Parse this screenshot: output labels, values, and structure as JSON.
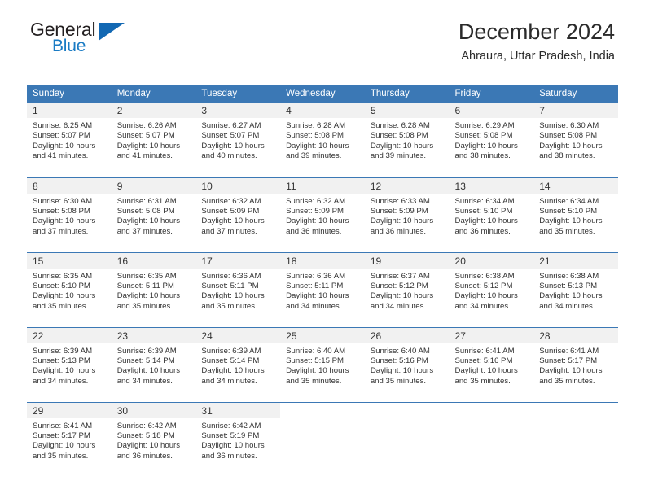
{
  "brand": {
    "word_one": "General",
    "word_two": "Blue",
    "triangle_icon": "triangle-icon"
  },
  "header": {
    "title": "December 2024",
    "subtitle": "Ahraura, Uttar Pradesh, India"
  },
  "calendar": {
    "weekday_headers": [
      "Sunday",
      "Monday",
      "Tuesday",
      "Wednesday",
      "Thursday",
      "Friday",
      "Saturday"
    ],
    "accent_color": "#3b78b5",
    "daynum_bg": "#f1f1f1",
    "weeks": [
      [
        {
          "day": "1",
          "sunrise": "Sunrise: 6:25 AM",
          "sunset": "Sunset: 5:07 PM",
          "daylight1": "Daylight: 10 hours",
          "daylight2": "and 41 minutes."
        },
        {
          "day": "2",
          "sunrise": "Sunrise: 6:26 AM",
          "sunset": "Sunset: 5:07 PM",
          "daylight1": "Daylight: 10 hours",
          "daylight2": "and 41 minutes."
        },
        {
          "day": "3",
          "sunrise": "Sunrise: 6:27 AM",
          "sunset": "Sunset: 5:07 PM",
          "daylight1": "Daylight: 10 hours",
          "daylight2": "and 40 minutes."
        },
        {
          "day": "4",
          "sunrise": "Sunrise: 6:28 AM",
          "sunset": "Sunset: 5:08 PM",
          "daylight1": "Daylight: 10 hours",
          "daylight2": "and 39 minutes."
        },
        {
          "day": "5",
          "sunrise": "Sunrise: 6:28 AM",
          "sunset": "Sunset: 5:08 PM",
          "daylight1": "Daylight: 10 hours",
          "daylight2": "and 39 minutes."
        },
        {
          "day": "6",
          "sunrise": "Sunrise: 6:29 AM",
          "sunset": "Sunset: 5:08 PM",
          "daylight1": "Daylight: 10 hours",
          "daylight2": "and 38 minutes."
        },
        {
          "day": "7",
          "sunrise": "Sunrise: 6:30 AM",
          "sunset": "Sunset: 5:08 PM",
          "daylight1": "Daylight: 10 hours",
          "daylight2": "and 38 minutes."
        }
      ],
      [
        {
          "day": "8",
          "sunrise": "Sunrise: 6:30 AM",
          "sunset": "Sunset: 5:08 PM",
          "daylight1": "Daylight: 10 hours",
          "daylight2": "and 37 minutes."
        },
        {
          "day": "9",
          "sunrise": "Sunrise: 6:31 AM",
          "sunset": "Sunset: 5:08 PM",
          "daylight1": "Daylight: 10 hours",
          "daylight2": "and 37 minutes."
        },
        {
          "day": "10",
          "sunrise": "Sunrise: 6:32 AM",
          "sunset": "Sunset: 5:09 PM",
          "daylight1": "Daylight: 10 hours",
          "daylight2": "and 37 minutes."
        },
        {
          "day": "11",
          "sunrise": "Sunrise: 6:32 AM",
          "sunset": "Sunset: 5:09 PM",
          "daylight1": "Daylight: 10 hours",
          "daylight2": "and 36 minutes."
        },
        {
          "day": "12",
          "sunrise": "Sunrise: 6:33 AM",
          "sunset": "Sunset: 5:09 PM",
          "daylight1": "Daylight: 10 hours",
          "daylight2": "and 36 minutes."
        },
        {
          "day": "13",
          "sunrise": "Sunrise: 6:34 AM",
          "sunset": "Sunset: 5:10 PM",
          "daylight1": "Daylight: 10 hours",
          "daylight2": "and 36 minutes."
        },
        {
          "day": "14",
          "sunrise": "Sunrise: 6:34 AM",
          "sunset": "Sunset: 5:10 PM",
          "daylight1": "Daylight: 10 hours",
          "daylight2": "and 35 minutes."
        }
      ],
      [
        {
          "day": "15",
          "sunrise": "Sunrise: 6:35 AM",
          "sunset": "Sunset: 5:10 PM",
          "daylight1": "Daylight: 10 hours",
          "daylight2": "and 35 minutes."
        },
        {
          "day": "16",
          "sunrise": "Sunrise: 6:35 AM",
          "sunset": "Sunset: 5:11 PM",
          "daylight1": "Daylight: 10 hours",
          "daylight2": "and 35 minutes."
        },
        {
          "day": "17",
          "sunrise": "Sunrise: 6:36 AM",
          "sunset": "Sunset: 5:11 PM",
          "daylight1": "Daylight: 10 hours",
          "daylight2": "and 35 minutes."
        },
        {
          "day": "18",
          "sunrise": "Sunrise: 6:36 AM",
          "sunset": "Sunset: 5:11 PM",
          "daylight1": "Daylight: 10 hours",
          "daylight2": "and 34 minutes."
        },
        {
          "day": "19",
          "sunrise": "Sunrise: 6:37 AM",
          "sunset": "Sunset: 5:12 PM",
          "daylight1": "Daylight: 10 hours",
          "daylight2": "and 34 minutes."
        },
        {
          "day": "20",
          "sunrise": "Sunrise: 6:38 AM",
          "sunset": "Sunset: 5:12 PM",
          "daylight1": "Daylight: 10 hours",
          "daylight2": "and 34 minutes."
        },
        {
          "day": "21",
          "sunrise": "Sunrise: 6:38 AM",
          "sunset": "Sunset: 5:13 PM",
          "daylight1": "Daylight: 10 hours",
          "daylight2": "and 34 minutes."
        }
      ],
      [
        {
          "day": "22",
          "sunrise": "Sunrise: 6:39 AM",
          "sunset": "Sunset: 5:13 PM",
          "daylight1": "Daylight: 10 hours",
          "daylight2": "and 34 minutes."
        },
        {
          "day": "23",
          "sunrise": "Sunrise: 6:39 AM",
          "sunset": "Sunset: 5:14 PM",
          "daylight1": "Daylight: 10 hours",
          "daylight2": "and 34 minutes."
        },
        {
          "day": "24",
          "sunrise": "Sunrise: 6:39 AM",
          "sunset": "Sunset: 5:14 PM",
          "daylight1": "Daylight: 10 hours",
          "daylight2": "and 34 minutes."
        },
        {
          "day": "25",
          "sunrise": "Sunrise: 6:40 AM",
          "sunset": "Sunset: 5:15 PM",
          "daylight1": "Daylight: 10 hours",
          "daylight2": "and 35 minutes."
        },
        {
          "day": "26",
          "sunrise": "Sunrise: 6:40 AM",
          "sunset": "Sunset: 5:16 PM",
          "daylight1": "Daylight: 10 hours",
          "daylight2": "and 35 minutes."
        },
        {
          "day": "27",
          "sunrise": "Sunrise: 6:41 AM",
          "sunset": "Sunset: 5:16 PM",
          "daylight1": "Daylight: 10 hours",
          "daylight2": "and 35 minutes."
        },
        {
          "day": "28",
          "sunrise": "Sunrise: 6:41 AM",
          "sunset": "Sunset: 5:17 PM",
          "daylight1": "Daylight: 10 hours",
          "daylight2": "and 35 minutes."
        }
      ],
      [
        {
          "day": "29",
          "sunrise": "Sunrise: 6:41 AM",
          "sunset": "Sunset: 5:17 PM",
          "daylight1": "Daylight: 10 hours",
          "daylight2": "and 35 minutes."
        },
        {
          "day": "30",
          "sunrise": "Sunrise: 6:42 AM",
          "sunset": "Sunset: 5:18 PM",
          "daylight1": "Daylight: 10 hours",
          "daylight2": "and 36 minutes."
        },
        {
          "day": "31",
          "sunrise": "Sunrise: 6:42 AM",
          "sunset": "Sunset: 5:19 PM",
          "daylight1": "Daylight: 10 hours",
          "daylight2": "and 36 minutes."
        },
        {
          "day": "",
          "sunrise": "",
          "sunset": "",
          "daylight1": "",
          "daylight2": ""
        },
        {
          "day": "",
          "sunrise": "",
          "sunset": "",
          "daylight1": "",
          "daylight2": ""
        },
        {
          "day": "",
          "sunrise": "",
          "sunset": "",
          "daylight1": "",
          "daylight2": ""
        },
        {
          "day": "",
          "sunrise": "",
          "sunset": "",
          "daylight1": "",
          "daylight2": ""
        }
      ]
    ]
  }
}
